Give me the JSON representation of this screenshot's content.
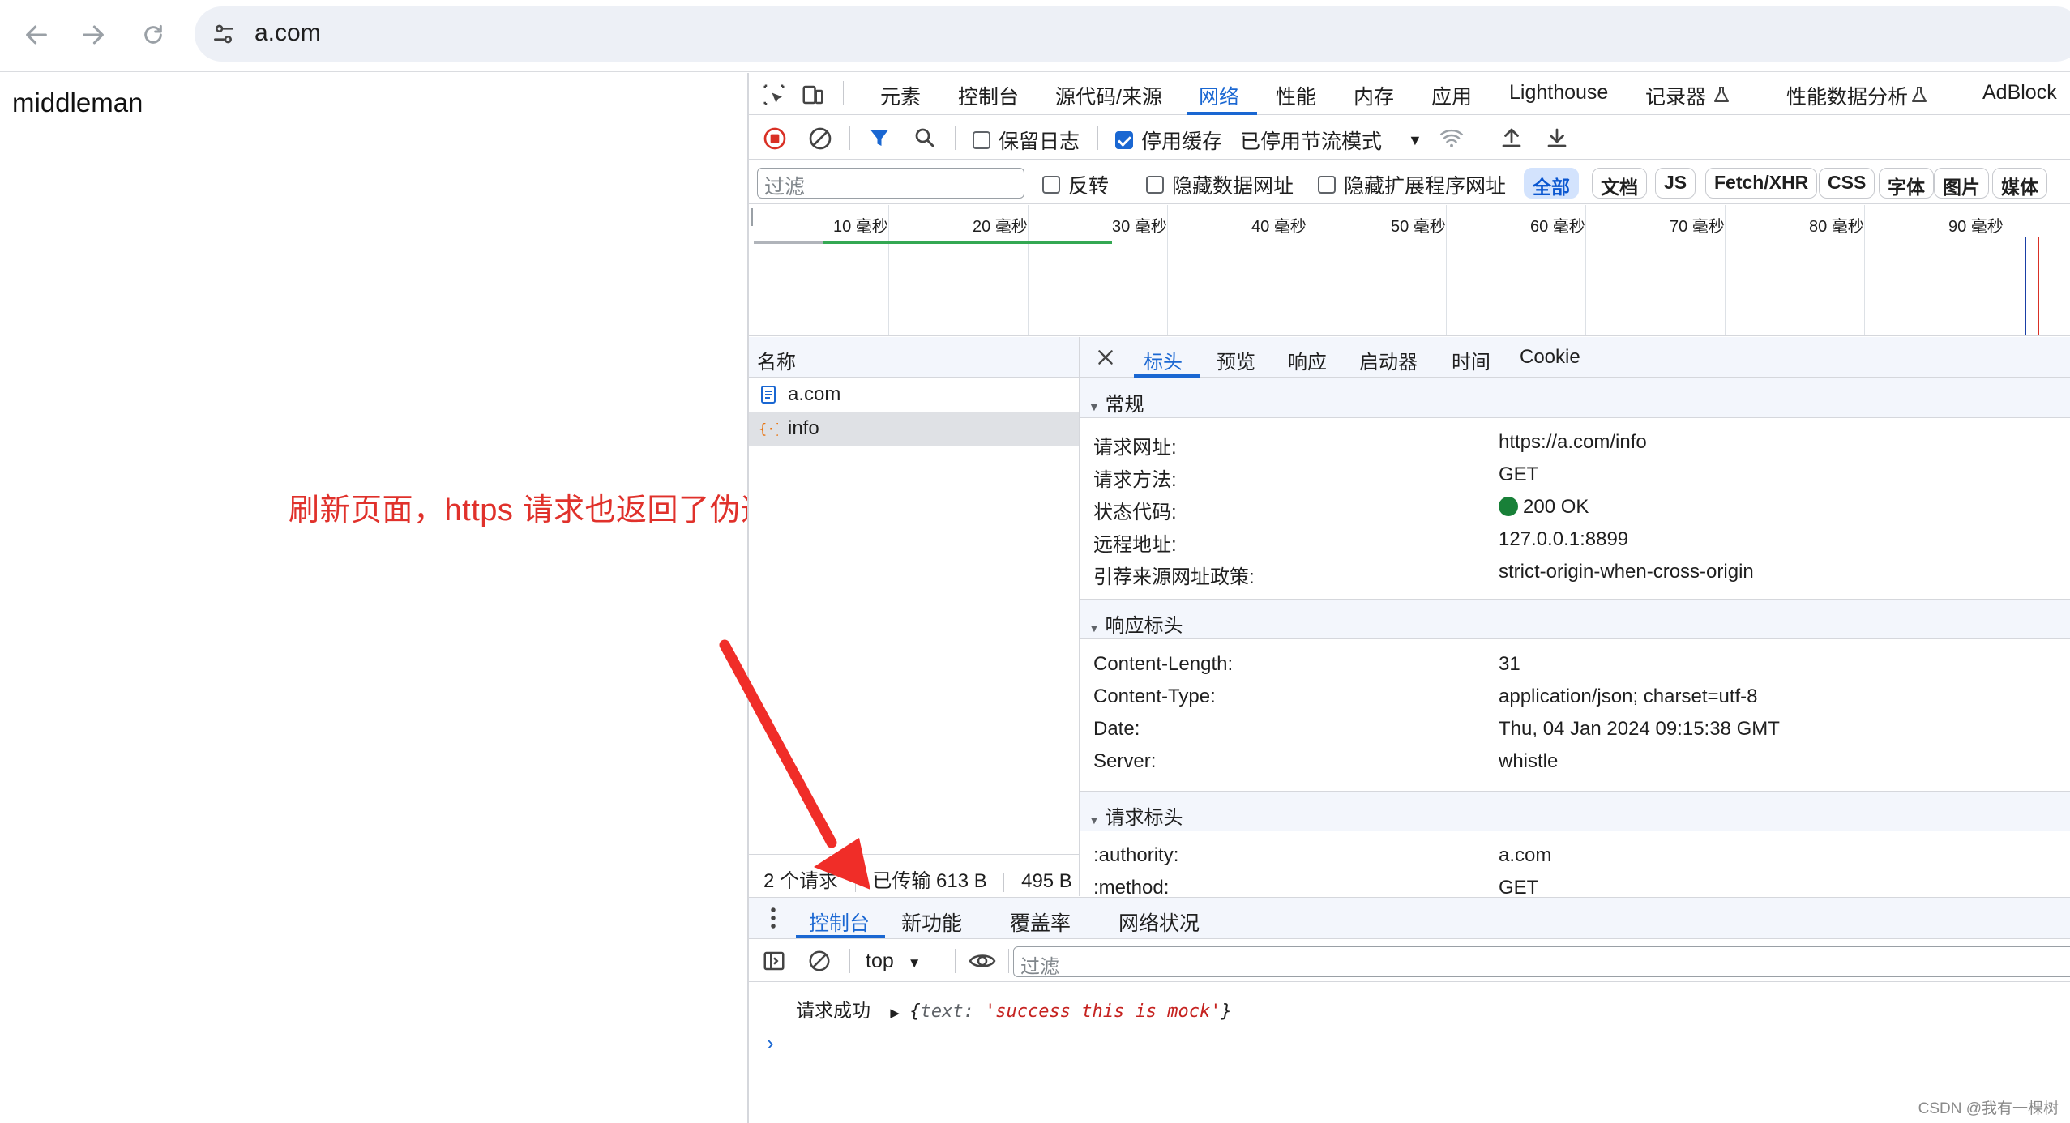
{
  "browser": {
    "url": "a.com",
    "icons": [
      "back-arrow-icon",
      "forward-arrow-icon",
      "reload-icon",
      "site-settings-icon"
    ]
  },
  "page": {
    "text": "middleman",
    "annotation": "刷新页面，https 请求也返回了伪造的请求",
    "annotation_color": "#e0312b"
  },
  "devtools": {
    "tabs": [
      "元素",
      "控制台",
      "源代码/来源",
      "网络",
      "性能",
      "内存",
      "应用",
      "Lighthouse",
      "记录器",
      "性能数据分析",
      "AdBlock"
    ],
    "active_tab": "网络",
    "toolbar": {
      "preserve_log": "保留日志",
      "disable_cache": "停用缓存",
      "throttling": "已停用节流模式"
    },
    "filter_bar": {
      "placeholder": "过滤",
      "invert": "反转",
      "hide_data_urls": "隐藏数据网址",
      "hide_extension_urls": "隐藏扩展程序网址",
      "types": [
        "全部",
        "文档",
        "JS",
        "Fetch/XHR",
        "CSS",
        "字体",
        "图片",
        "媒体"
      ]
    },
    "overview_ticks": [
      "10 毫秒",
      "20 毫秒",
      "30 毫秒",
      "40 毫秒",
      "50 毫秒",
      "60 毫秒",
      "70 毫秒",
      "80 毫秒",
      "90 毫秒"
    ],
    "request_list": {
      "header": "名称",
      "rows": [
        {
          "name": "a.com",
          "icon": "document-icon"
        },
        {
          "name": "info",
          "icon": "fetch-icon"
        }
      ],
      "footer": {
        "requests": "2 个请求",
        "transferred": "已传输 613 B",
        "resources": "495 B"
      }
    },
    "details": {
      "tabs": [
        "标头",
        "预览",
        "响应",
        "启动器",
        "时间",
        "Cookie"
      ],
      "active_tab": "标头",
      "general": {
        "title": "常规",
        "rows": [
          {
            "key": "请求网址:",
            "value": "https://a.com/info"
          },
          {
            "key": "请求方法:",
            "value": "GET"
          },
          {
            "key": "状态代码:",
            "value": "200 OK"
          },
          {
            "key": "远程地址:",
            "value": "127.0.0.1:8899"
          },
          {
            "key": "引荐来源网址政策:",
            "value": "strict-origin-when-cross-origin"
          }
        ]
      },
      "response_headers": {
        "title": "响应标头",
        "rows": [
          {
            "key": "Content-Length:",
            "value": "31"
          },
          {
            "key": "Content-Type:",
            "value": "application/json; charset=utf-8"
          },
          {
            "key": "Date:",
            "value": "Thu, 04 Jan 2024 09:15:38 GMT"
          },
          {
            "key": "Server:",
            "value": "whistle"
          }
        ]
      },
      "request_headers": {
        "title": "请求标头",
        "rows": [
          {
            "key": ":authority:",
            "value": "a.com"
          },
          {
            "key": ":method:",
            "value": "GET"
          }
        ]
      }
    },
    "drawer": {
      "tabs": [
        "控制台",
        "新功能",
        "覆盖率",
        "网络状况"
      ],
      "active_tab": "控制台",
      "context": "top",
      "filter_placeholder": "过滤",
      "log": {
        "message": "请求成功",
        "object_key": "text",
        "object_value": "'success this is mock'"
      }
    }
  },
  "watermark": "CSDN @我有一棵树"
}
